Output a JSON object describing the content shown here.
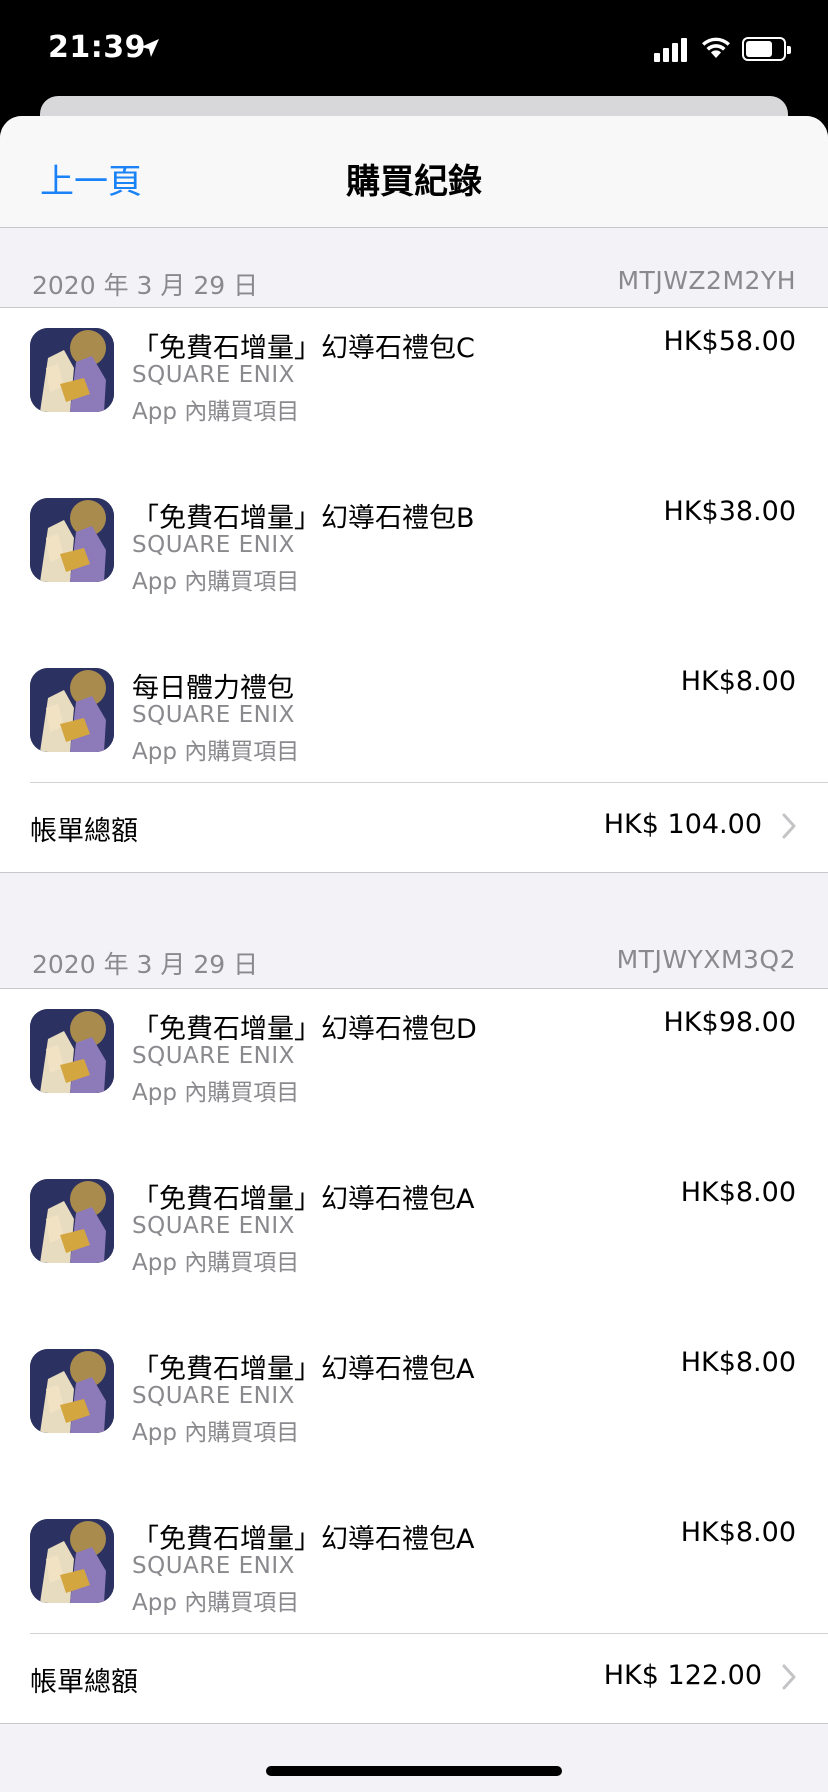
{
  "status": {
    "time": "21:39"
  },
  "nav": {
    "back": "上一頁",
    "title": "購買紀錄"
  },
  "receipts": [
    {
      "date": "2020 年 3 月 29 日",
      "code": "MTJWZ2M2YH",
      "items": [
        {
          "name": "「免費石增量」幻導石禮包C",
          "developer": "SQUARE ENIX",
          "kind": "App 內購買項目",
          "price": "HK$58.00"
        },
        {
          "name": "「免費石增量」幻導石禮包B",
          "developer": "SQUARE ENIX",
          "kind": "App 內購買項目",
          "price": "HK$38.00"
        },
        {
          "name": "每日體力禮包",
          "developer": "SQUARE ENIX",
          "kind": "App 內購買項目",
          "price": "HK$8.00"
        }
      ],
      "total_label": "帳單總額",
      "total": "HK$ 104.00"
    },
    {
      "date": "2020 年 3 月 29 日",
      "code": "MTJWYXM3Q2",
      "items": [
        {
          "name": "「免費石增量」幻導石禮包D",
          "developer": "SQUARE ENIX",
          "kind": "App 內購買項目",
          "price": "HK$98.00"
        },
        {
          "name": "「免費石增量」幻導石禮包A",
          "developer": "SQUARE ENIX",
          "kind": "App 內購買項目",
          "price": "HK$8.00"
        },
        {
          "name": "「免費石增量」幻導石禮包A",
          "developer": "SQUARE ENIX",
          "kind": "App 內購買項目",
          "price": "HK$8.00"
        },
        {
          "name": "「免費石增量」幻導石禮包A",
          "developer": "SQUARE ENIX",
          "kind": "App 內購買項目",
          "price": "HK$8.00"
        }
      ],
      "total_label": "帳單總額",
      "total": "HK$ 122.00"
    }
  ],
  "colors": {
    "accent": "#1a82f7",
    "secondary_text": "#8a8a8e",
    "background": "#f2f2f7"
  },
  "icons": [
    "location-arrow-icon",
    "cellular-signal-icon",
    "wifi-icon",
    "battery-icon",
    "app-icon",
    "chevron-right-icon"
  ]
}
